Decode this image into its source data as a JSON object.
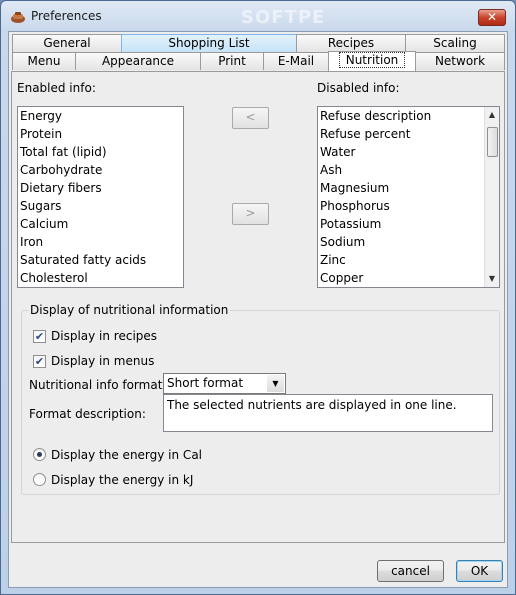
{
  "window": {
    "title": "Preferences",
    "close_symbol": "✕"
  },
  "watermark": "SOFTPE",
  "tabs_row1": [
    {
      "label": "General"
    },
    {
      "label": "Shopping List"
    },
    {
      "label": "Recipes"
    },
    {
      "label": "Scaling"
    }
  ],
  "tabs_row2": [
    {
      "label": "Menu"
    },
    {
      "label": "Appearance"
    },
    {
      "label": "Print"
    },
    {
      "label": "E-Mail"
    },
    {
      "label": "Nutrition"
    },
    {
      "label": "Network"
    }
  ],
  "nutrition": {
    "enabled_label": "Enabled info:",
    "disabled_label": "Disabled info:",
    "enabled_items": [
      "Energy",
      "Protein",
      "Total fat (lipid)",
      "Carbohydrate",
      "Dietary fibers",
      "Sugars",
      "Calcium",
      "Iron",
      "Saturated fatty acids",
      "Cholesterol"
    ],
    "disabled_items": [
      "Refuse description",
      "Refuse percent",
      "Water",
      "Ash",
      "Magnesium",
      "Phosphorus",
      "Potassium",
      "Sodium",
      "Zinc",
      "Copper"
    ],
    "move_left": "<",
    "move_right": ">",
    "group_title": "Display of nutritional information",
    "display_in_recipes": "Display in recipes",
    "display_in_menus": "Display in menus",
    "format_label": "Nutritional info format:",
    "format_value": "Short format",
    "description_label": "Format description:",
    "description_value": "The selected nutrients are displayed in one line.",
    "energy_cal": "Display the energy in Cal",
    "energy_kj": "Display the energy in kJ",
    "checks": {
      "recipes": true,
      "menus": true
    },
    "energy_unit_selected": "Cal"
  },
  "buttons": {
    "cancel": "cancel",
    "ok": "OK"
  },
  "colors": {
    "accent_tab": "#c6e4f8",
    "title_bar": "#c9d9ec",
    "close_red": "#c8442c"
  }
}
